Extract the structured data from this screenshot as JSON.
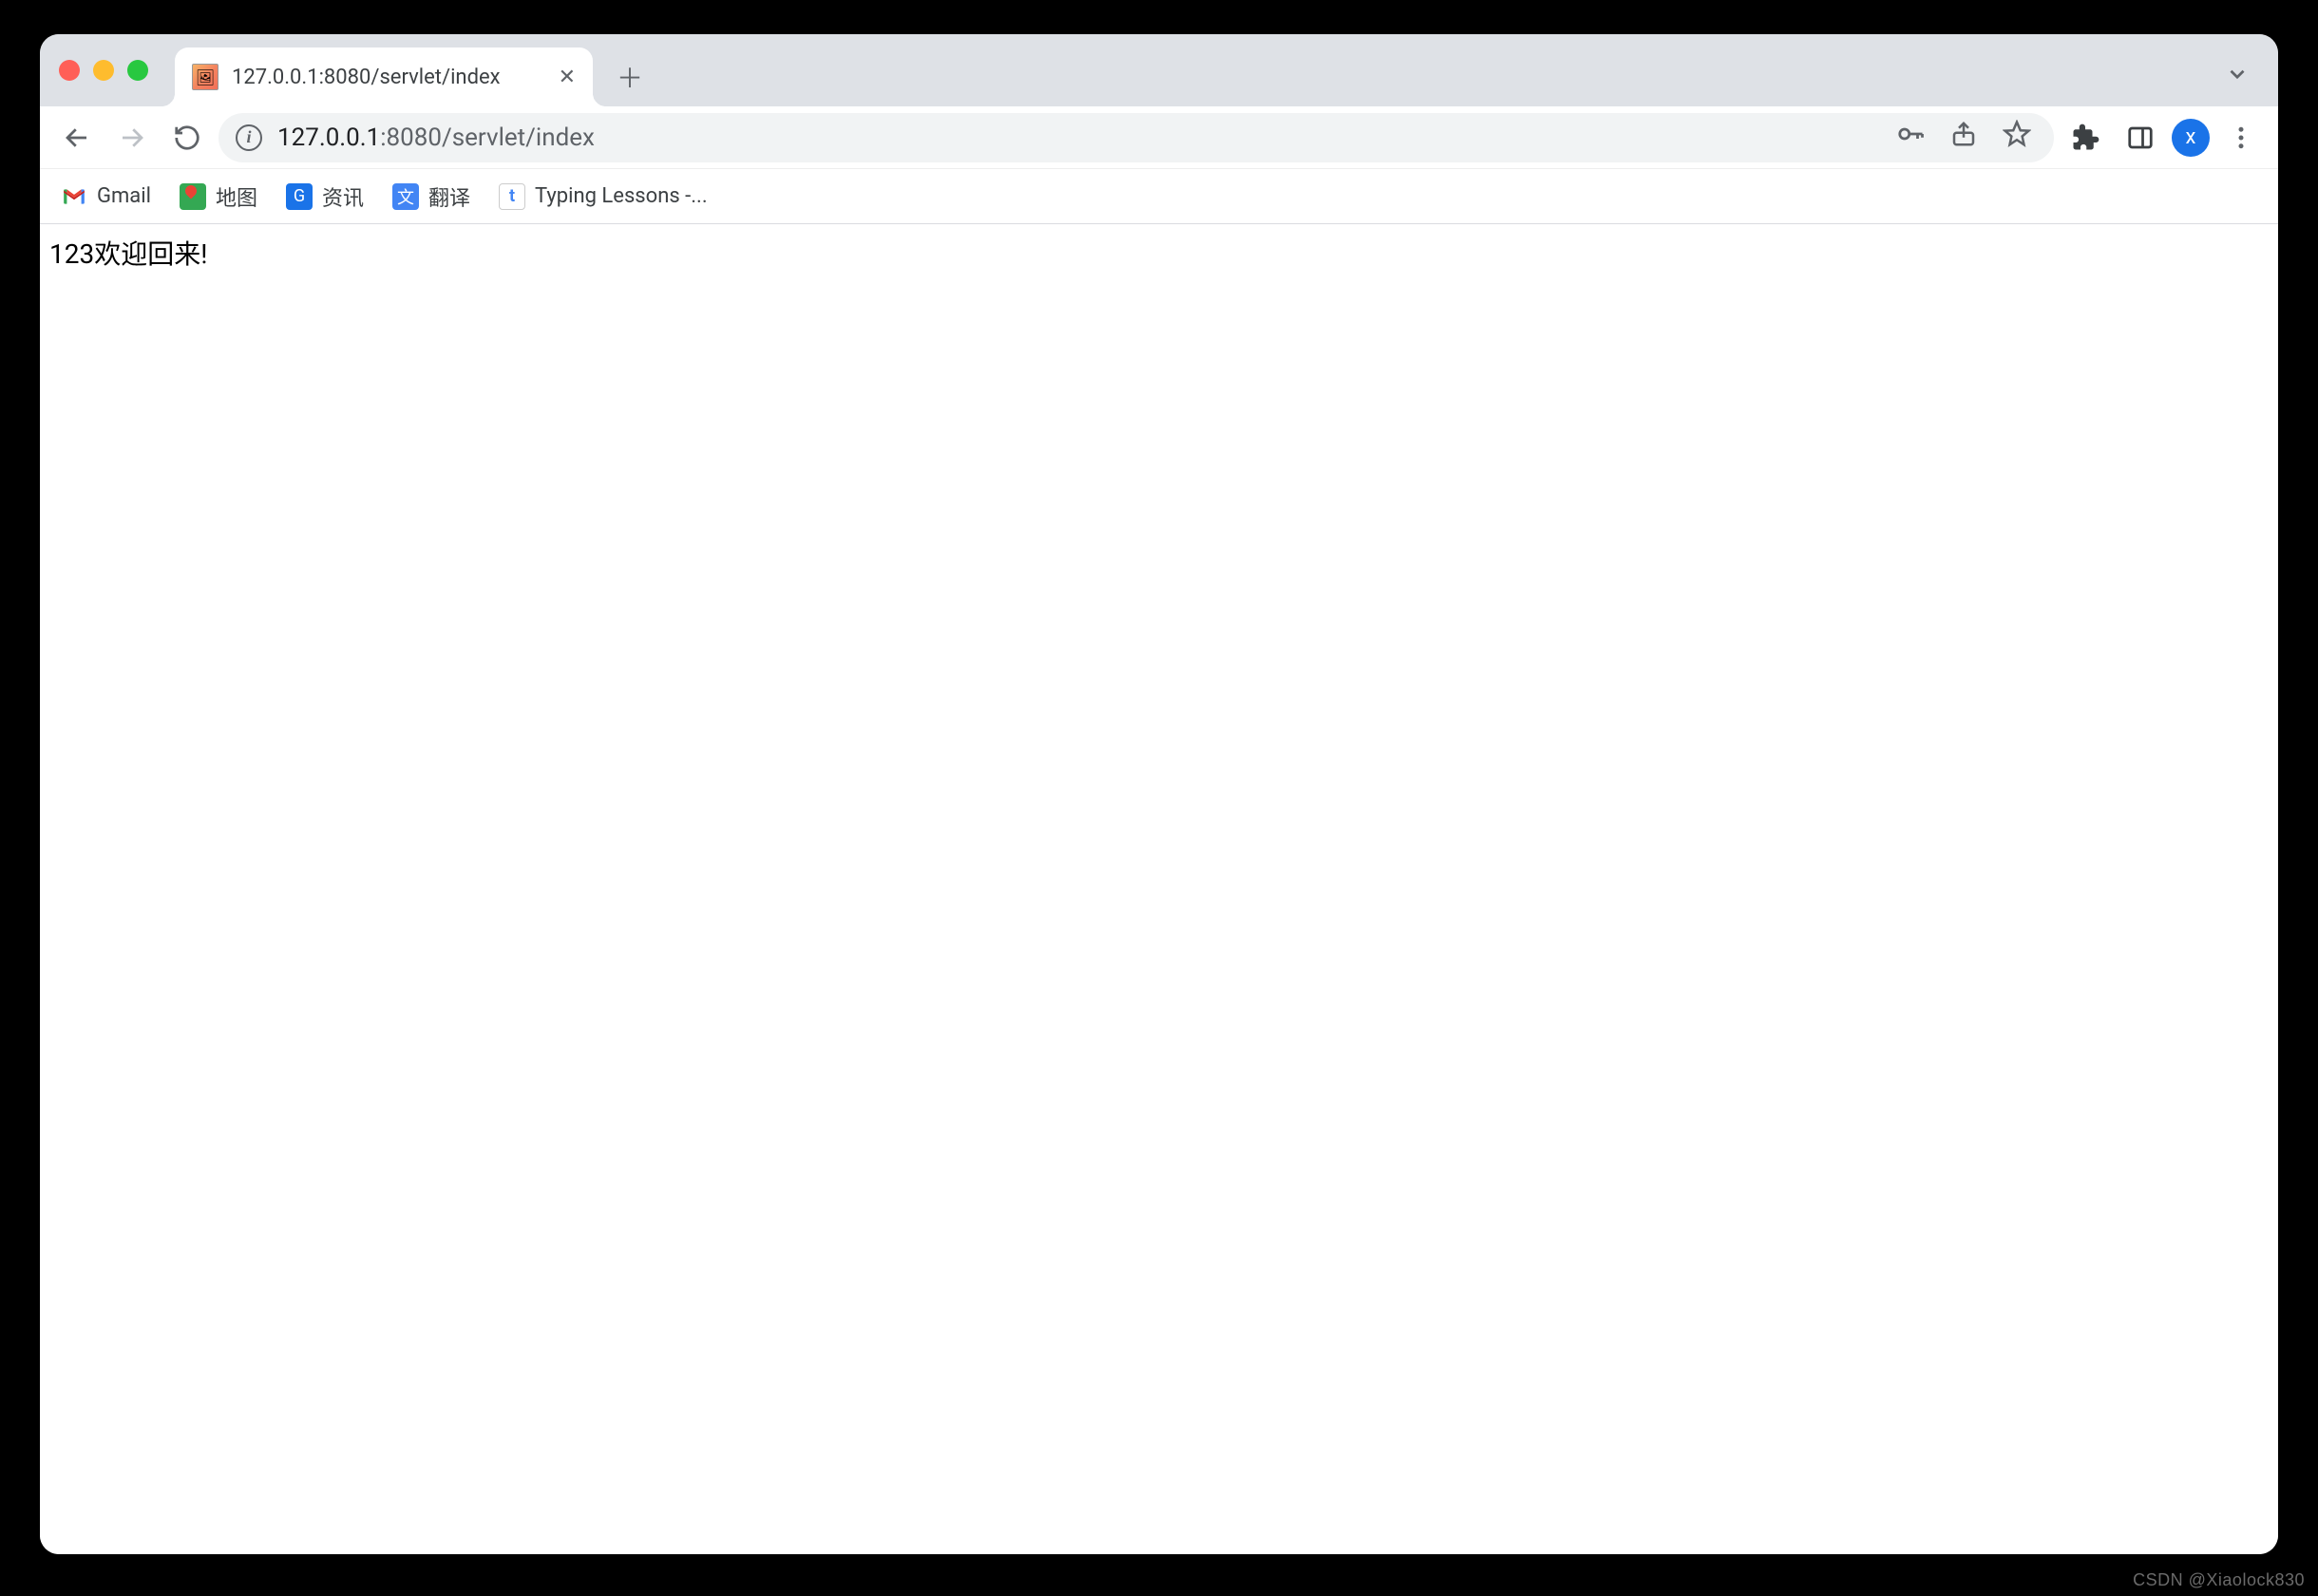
{
  "tab": {
    "title": "127.0.0.1:8080/servlet/index"
  },
  "omnibox": {
    "host": "127.0.0.1",
    "rest": ":8080/servlet/index"
  },
  "bookmarks": [
    {
      "label": "Gmail"
    },
    {
      "label": "地图"
    },
    {
      "label": "资讯"
    },
    {
      "label": "翻译"
    },
    {
      "label": "Typing Lessons -..."
    }
  ],
  "page": {
    "body_text": "123欢迎回来!"
  },
  "profile": {
    "initial": "x"
  },
  "watermark": "CSDN @Xiaolock830"
}
